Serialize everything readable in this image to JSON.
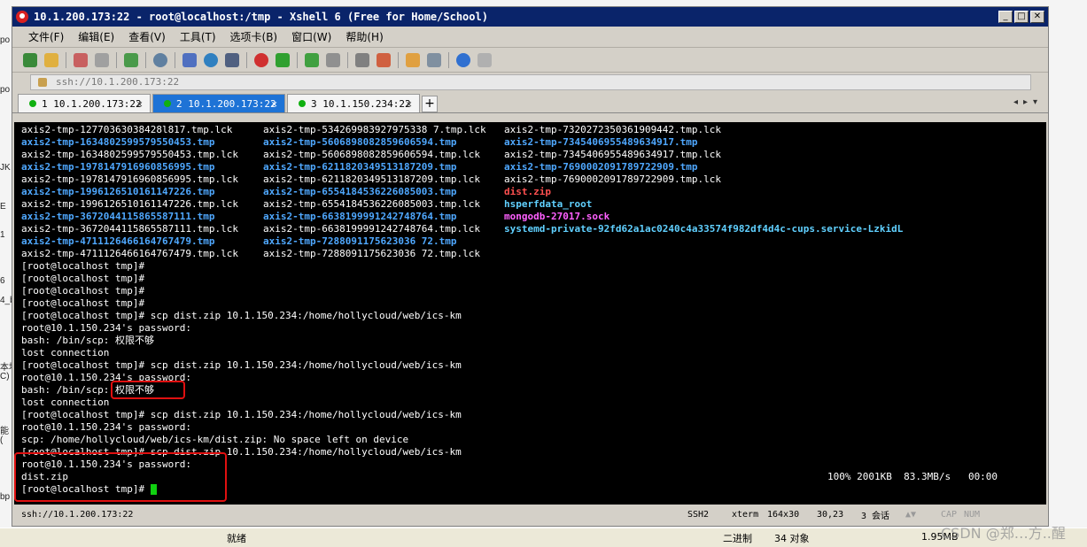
{
  "window": {
    "title": "10.1.200.173:22 - root@localhost:/tmp - Xshell 6 (Free for Home/School)",
    "controls": [
      "_",
      "□",
      "✕"
    ]
  },
  "menu": [
    "文件(F)",
    "编辑(E)",
    "查看(V)",
    "工具(T)",
    "选项卡(B)",
    "窗口(W)",
    "帮助(H)"
  ],
  "address": "ssh://10.1.200.173:22",
  "tabs": [
    {
      "label": "1 10.1.200.173:22",
      "active": false
    },
    {
      "label": "2 10.1.200.173:22",
      "active": true
    },
    {
      "label": "3 10.1.150.234:22",
      "active": false
    }
  ],
  "terminal": {
    "listing": [
      [
        "axis2-tmp-12770363038428l817.tmp.lck",
        "axis2-tmp-534269983927975338 7.tmp.lck",
        "axis2-tmp-7320272350361909442.tmp.lck"
      ],
      [
        "axis2-tmp-1634802599579550453.tmp",
        "axis2-tmp-5606898082859606594.tmp",
        "axis2-tmp-7345406955489634917.tmp"
      ],
      [
        "axis2-tmp-1634802599579550453.tmp.lck",
        "axis2-tmp-5606898082859606594.tmp.lck",
        "axis2-tmp-7345406955489634917.tmp.lck"
      ],
      [
        "axis2-tmp-1978147916960856995.tmp",
        "axis2-tmp-6211820349513187209.tmp",
        "axis2-tmp-7690002091789722909.tmp"
      ],
      [
        "axis2-tmp-1978147916960856995.tmp.lck",
        "axis2-tmp-6211820349513187209.tmp.lck",
        "axis2-tmp-7690002091789722909.tmp.lck"
      ],
      [
        "axis2-tmp-1996126510161147226.tmp",
        "axis2-tmp-6554184536226085003.tmp",
        "dist.zip"
      ],
      [
        "axis2-tmp-1996126510161147226.tmp.lck",
        "axis2-tmp-6554184536226085003.tmp.lck",
        "hsperfdata_root"
      ],
      [
        "axis2-tmp-3672044115865587111.tmp",
        "axis2-tmp-6638199991242748764.tmp",
        "mongodb-27017.sock"
      ],
      [
        "axis2-tmp-3672044115865587111.tmp.lck",
        "axis2-tmp-6638199991242748764.tmp.lck",
        "systemd-private-92fd62a1ac0240c4a33574f982df4d4c-cups.service-LzkidL"
      ],
      [
        "axis2-tmp-4711126466164767479.tmp",
        "axis2-tmp-7288091175623036 72.tmp",
        ""
      ],
      [
        "axis2-tmp-4711126466164767479.tmp.lck",
        "axis2-tmp-7288091175623036 72.tmp.lck",
        ""
      ]
    ],
    "lines": [
      "[root@localhost tmp]#",
      "[root@localhost tmp]#",
      "[root@localhost tmp]#",
      "[root@localhost tmp]#",
      "[root@localhost tmp]# scp dist.zip 10.1.150.234:/home/hollycloud/web/ics-km",
      "root@10.1.150.234's password:",
      "bash: /bin/scp: 权限不够",
      "lost connection",
      "[root@localhost tmp]# scp dist.zip 10.1.150.234:/home/hollycloud/web/ics-km",
      "root@10.1.150.234's password:",
      "bash: /bin/scp: 权限不够",
      "lost connection",
      "[root@localhost tmp]# scp dist.zip 10.1.150.234:/home/hollycloud/web/ics-km",
      "root@10.1.150.234's password:",
      "scp: /home/hollycloud/web/ics-km/dist.zip: No space left on device",
      "[root@localhost tmp]# scp dist.zip 10.1.150.234:/home/hollycloud/web/ics-km",
      "root@10.1.150.234's password:",
      "dist.zip",
      "[root@localhost tmp]# "
    ],
    "transfer": "100% 2001KB  83.3MB/s   00:00"
  },
  "status": {
    "conn": "ssh://10.1.200.173:22",
    "proto": "SSH2",
    "term": "xterm",
    "size": "164x30",
    "pos": "30,23",
    "sessions": "3 会话",
    "caps": "CAP",
    "num": "NUM"
  },
  "taskbar": {
    "left": "就绪",
    "mode": "二进制",
    "count": "34 对象",
    "size": "1.95MB",
    "watermark": "CSDN @郑…方..醒"
  },
  "desktop_fragments": [
    "po",
    "po",
    "JK",
    "E",
    "1",
    "6",
    "4_b",
    "本地",
    "C)",
    "能",
    "(",
    "bp"
  ]
}
